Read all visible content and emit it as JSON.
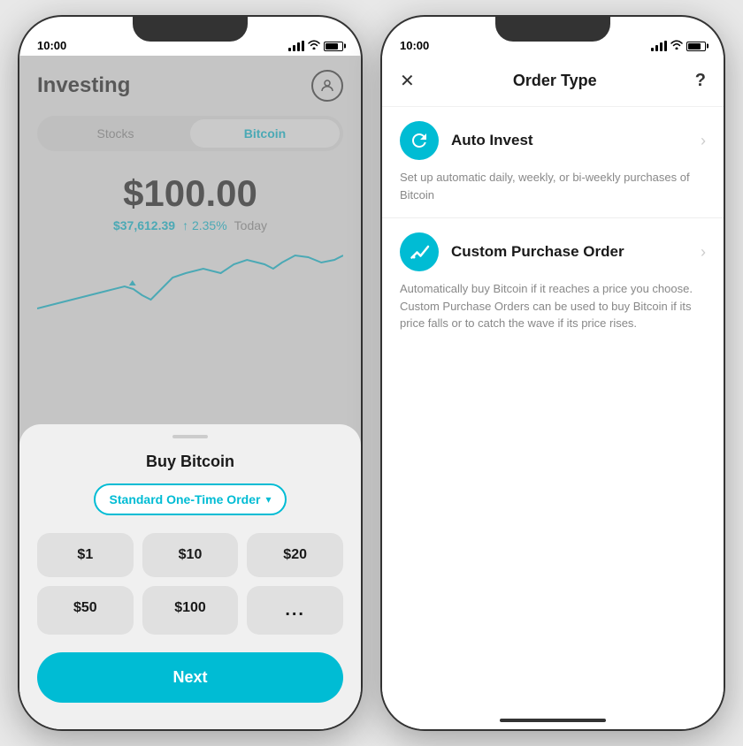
{
  "left_phone": {
    "status_time": "10:00",
    "header": {
      "title": "Investing",
      "profile_icon_label": "profile"
    },
    "tabs": [
      {
        "label": "Stocks",
        "active": false
      },
      {
        "label": "Bitcoin",
        "active": true
      }
    ],
    "price_display": "$100.00",
    "btc_price": "$37,612.39",
    "price_change": "↑ 2.35%",
    "price_period": "Today",
    "modal": {
      "title": "Buy Bitcoin",
      "order_type": "Standard One-Time Order",
      "order_type_chevron": "▾",
      "amounts": [
        "$1",
        "$10",
        "$20",
        "$50",
        "$100",
        "..."
      ],
      "next_btn": "Next"
    }
  },
  "right_phone": {
    "status_time": "10:00",
    "header": {
      "close_label": "✕",
      "title": "Order Type",
      "help_label": "?"
    },
    "options": [
      {
        "icon": "↺",
        "name": "Auto Invest",
        "description": "Set up automatic daily, weekly, or bi-weekly purchases of Bitcoin"
      },
      {
        "icon": "〜",
        "name": "Custom Purchase Order",
        "description": "Automatically buy Bitcoin if it reaches a price you choose. Custom Purchase Orders can be used to buy Bitcoin if its price falls or to catch the wave if its price rises."
      }
    ]
  }
}
